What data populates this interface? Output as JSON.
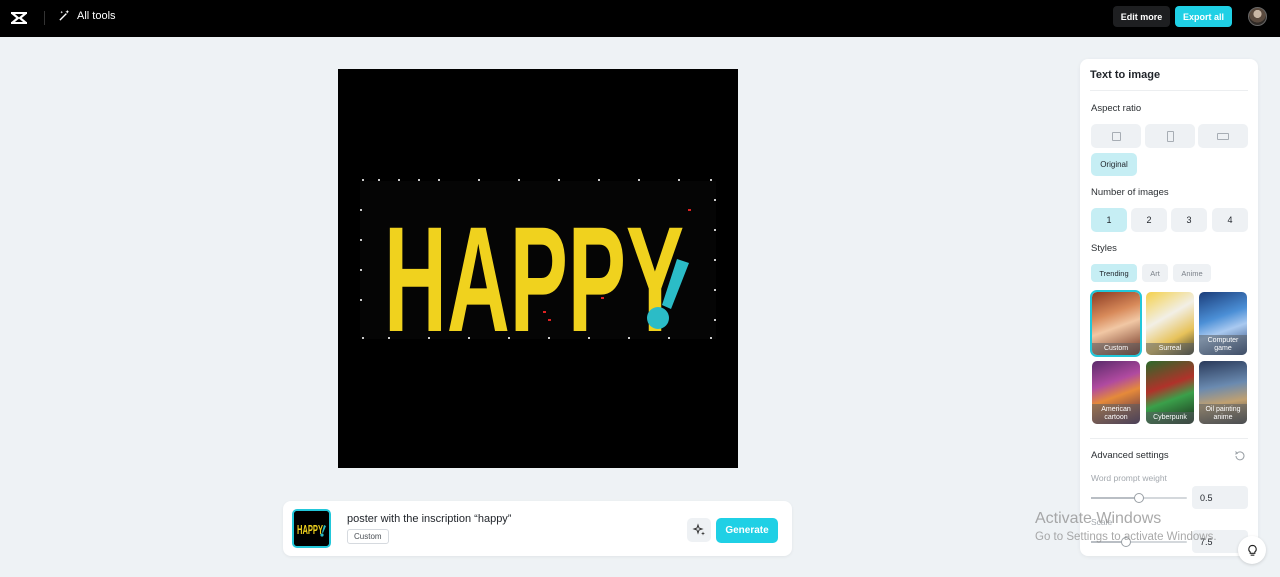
{
  "header": {
    "all_tools_label": "All tools",
    "edit_more_label": "Edit more",
    "export_all_label": "Export all",
    "accent_color": "#1fd0e5"
  },
  "canvas": {
    "image_text": "HAPPY",
    "image_punctuation": "!"
  },
  "prompt": {
    "thumbnail_text": "HAPPY",
    "text": "poster with the inscription “happy”",
    "style_tag": "Custom",
    "generate_label": "Generate"
  },
  "panel": {
    "title": "Text to image",
    "aspect_ratio_label": "Aspect ratio",
    "aspect_options": [
      "square",
      "portrait",
      "landscape"
    ],
    "original_label": "Original",
    "number_label": "Number of images",
    "numbers": [
      "1",
      "2",
      "3",
      "4"
    ],
    "selected_number": "1",
    "styles_label": "Styles",
    "style_tabs": [
      "Trending",
      "Art",
      "Anime"
    ],
    "active_style_tab": "Trending",
    "styles": [
      {
        "label": "Custom",
        "selected": true
      },
      {
        "label": "Surreal",
        "selected": false
      },
      {
        "label": "Computer game",
        "selected": false
      },
      {
        "label": "American cartoon",
        "selected": false
      },
      {
        "label": "Cyberpunk",
        "selected": false
      },
      {
        "label": "Oil painting anime",
        "selected": false
      }
    ],
    "advanced_label": "Advanced settings",
    "word_prompt_weight_label": "Word prompt weight",
    "word_prompt_weight_value": "0.5",
    "scale_label": "Scale",
    "scale_value": "7.5"
  },
  "watermark": {
    "line1": "Activate Windows",
    "line2": "Go to Settings to activate Windows."
  }
}
